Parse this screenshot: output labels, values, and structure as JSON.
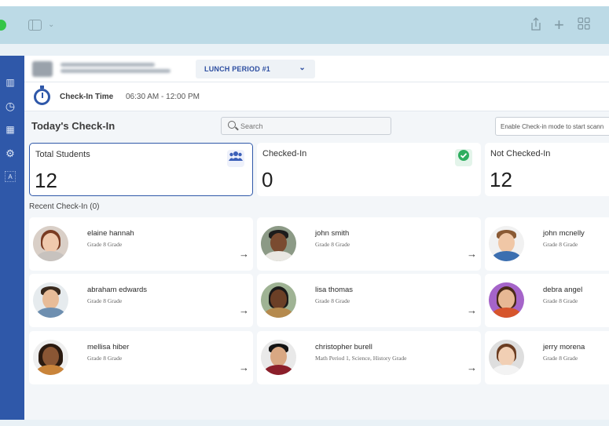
{
  "window": {
    "titlebar_icons": [
      "sidebar-toggle-icon",
      "chevron-down-icon",
      "share-icon",
      "plus-icon",
      "grid-icon"
    ],
    "titlebar_glyphs": {
      "chevron": "⌄",
      "plus": "+",
      "grid": "⊞"
    }
  },
  "rail": {
    "items": [
      {
        "icon": "bar-chart-icon",
        "glyph": "▥"
      },
      {
        "icon": "clock-icon",
        "glyph": "◷"
      },
      {
        "icon": "calendar-icon",
        "glyph": "▦"
      },
      {
        "icon": "settings-icon",
        "glyph": "⚙"
      },
      {
        "icon": "letter-a-icon",
        "glyph": "A"
      }
    ]
  },
  "header": {
    "period_selector": {
      "value": "LUNCH PERIOD #1",
      "caret": "⌄"
    },
    "checkin_time_label": "Check-In Time",
    "checkin_time_range": "06:30 AM - 12:00 PM"
  },
  "toolbar": {
    "title": "Today's Check-In",
    "search_placeholder": "Search",
    "mode_hint": "Enable Check-in mode to start scann"
  },
  "stats": [
    {
      "label": "Total Students",
      "value": "12",
      "icon": "group-icon",
      "icon_glyph": "👥"
    },
    {
      "label": "Checked-In",
      "value": "0",
      "icon": "check-circle-icon",
      "icon_glyph": "✓"
    },
    {
      "label": "Not Checked-In",
      "value": "12"
    }
  ],
  "recent_label": "Recent Check-In (0)",
  "students": [
    {
      "name": "elaine hannah",
      "grade": "Grade 8 Grade"
    },
    {
      "name": "john smith",
      "grade": "Grade 8 Grade"
    },
    {
      "name": "john mcnelly",
      "grade": "Grade 8 Grade"
    },
    {
      "name": "abraham edwards",
      "grade": "Grade 8 Grade"
    },
    {
      "name": "lisa thomas",
      "grade": "Grade 8 Grade"
    },
    {
      "name": "debra angel",
      "grade": "Grade 8 Grade"
    },
    {
      "name": "mellisa hiber",
      "grade": "Grade 8 Grade"
    },
    {
      "name": "christopher burell",
      "grade": "Math Period 1, Science, History Grade"
    },
    {
      "name": "jerry morena",
      "grade": "Grade 8 Grade"
    }
  ],
  "arrow_glyph": "→",
  "colors": {
    "accent": "#2f58a9",
    "titlebar": "#bcdae6",
    "check_green": "#2eae5f"
  }
}
